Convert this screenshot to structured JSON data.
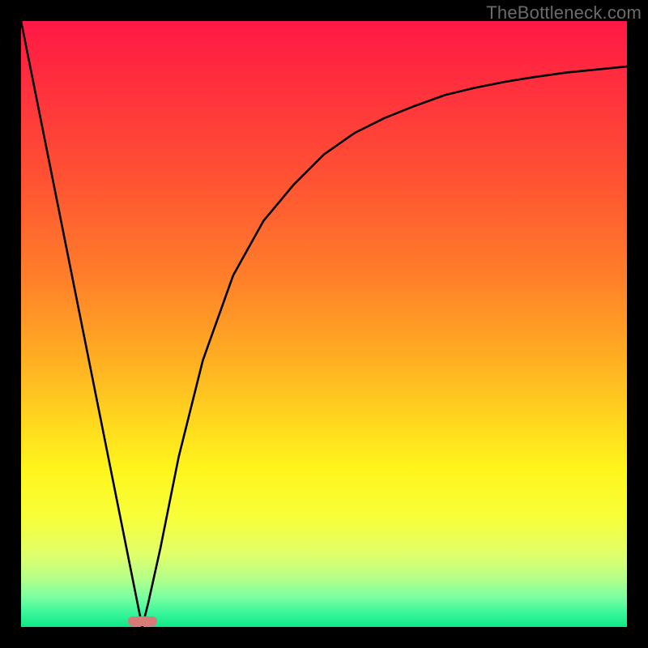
{
  "watermark": "TheBottleneck.com",
  "chart_data": {
    "type": "line",
    "title": "",
    "xlabel": "",
    "ylabel": "",
    "xlim": [
      0,
      100
    ],
    "ylim": [
      0,
      100
    ],
    "grid": false,
    "legend": false,
    "annotations": [],
    "series": [
      {
        "name": "curve",
        "x": [
          0,
          5,
          10,
          14,
          17,
          19,
          20,
          21,
          23,
          26,
          30,
          35,
          40,
          45,
          50,
          55,
          60,
          65,
          70,
          75,
          80,
          85,
          90,
          95,
          100
        ],
        "values": [
          100,
          75,
          50,
          30,
          15,
          5,
          0,
          4,
          13,
          28,
          44,
          58,
          67,
          73,
          78,
          81.5,
          84,
          86,
          87.8,
          89,
          90,
          90.8,
          91.5,
          92,
          92.5
        ]
      }
    ],
    "marker": {
      "x_center": 20,
      "width_pct": 4.8,
      "height_pct": 1.6,
      "color": "#d77b78"
    },
    "background_gradient": {
      "top": "#ff1846",
      "bottom": "#0fe884"
    }
  }
}
